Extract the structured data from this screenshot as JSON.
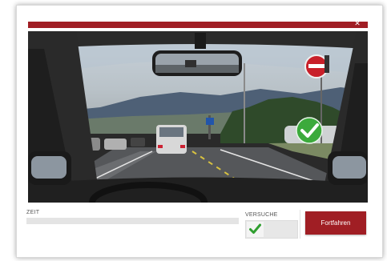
{
  "progress": {
    "label": "ZEIT",
    "value": 0.0
  },
  "attempts": {
    "label": "VERSUCHE",
    "icon": "check-icon",
    "correct": 1
  },
  "actions": {
    "continue_label": "Fortfahren"
  },
  "colors": {
    "accent": "#a01e24",
    "success": "#3caa3c",
    "check_mark": "#2f9e2f"
  },
  "scene": {
    "result_icon": "check-circle-icon",
    "sign": "no-entry-sign"
  }
}
